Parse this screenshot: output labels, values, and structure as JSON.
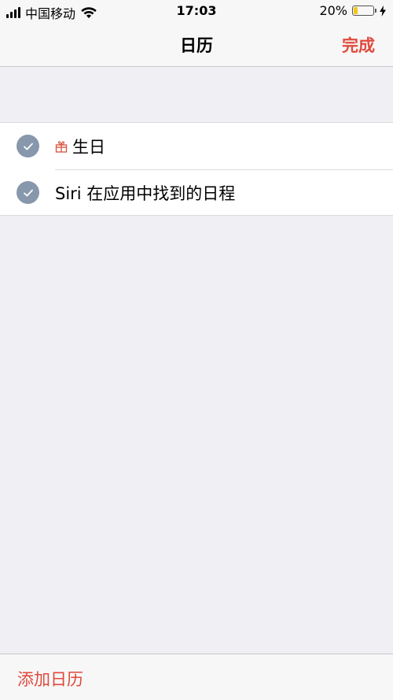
{
  "status_bar": {
    "carrier": "中国移动",
    "time": "17:03",
    "battery_percent": "20%",
    "battery_level": 0.2
  },
  "nav": {
    "title": "日历",
    "done_label": "完成"
  },
  "calendars": [
    {
      "label": "生日",
      "checked": true,
      "icon": "gift-icon"
    },
    {
      "label": "Siri 在应用中找到的日程",
      "checked": true
    }
  ],
  "toolbar": {
    "add_label": "添加日历"
  },
  "colors": {
    "accent": "#e0493c",
    "check": "#8797ac",
    "battery": "#f2c81a"
  }
}
